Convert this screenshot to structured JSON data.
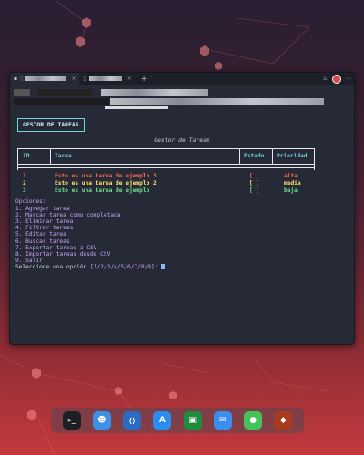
{
  "colors": {
    "accent": "#6fd3d8",
    "priority_high": "#ff6b4a",
    "priority_medium": "#ffe566",
    "priority_low": "#6be08a",
    "menu": "#c6a0f5"
  },
  "titlebar": {
    "tab_icon_1": "window-icon",
    "tab_icon_2": "terminal-icon",
    "new_tab": "+",
    "dropdown": "˅",
    "more": "⋯"
  },
  "app": {
    "title_button": "GESTOR DE TAREAS",
    "subtitle": "Gestor de Tareas"
  },
  "table": {
    "headers": [
      "ID",
      "Tarea",
      "Estado",
      "Prioridad"
    ],
    "rows": [
      {
        "id": "1",
        "task": "Esto es una tarea de ejemplo 3",
        "status": "[ ]",
        "priority": "alta",
        "color": "#ff6b4a"
      },
      {
        "id": "2",
        "task": "Esto es una tarea de ejemplo 2",
        "status": "[ ]",
        "priority": "media",
        "color": "#ffe566"
      },
      {
        "id": "3",
        "task": "Esto es una tarea de ejemplo",
        "status": "[ ]",
        "priority": "baja",
        "color": "#6be08a"
      }
    ]
  },
  "menu": {
    "heading": "Opciones:",
    "items": [
      "1. Agregar tarea",
      "2. Marcar tarea como completada",
      "3. Eliminar tarea",
      "4. Filtrar tareas",
      "5. Editar tarea",
      "6. Buscar tareas",
      "7. Exportar tareas a CSV",
      "8. Importar tareas desde CSV",
      "9. Salir"
    ]
  },
  "prompt": {
    "text": "Seleccione una opción ",
    "options": "[1/2/3/4/5/6/7/8/9]:"
  },
  "dock": [
    {
      "name": "terminal-icon",
      "glyph": ">_",
      "bg": "#1d1f24"
    },
    {
      "name": "finder-face-icon",
      "glyph": "☻",
      "bg": "#3e8fe6"
    },
    {
      "name": "vscode-icon",
      "glyph": "⟨⟩",
      "bg": "#2a6cc2"
    },
    {
      "name": "app-store-icon",
      "glyph": "A",
      "bg": "#2b8df2"
    },
    {
      "name": "google-classroom-icon",
      "glyph": "▣",
      "bg": "#1e8e3e"
    },
    {
      "name": "mail-icon",
      "glyph": "✉",
      "bg": "#3a8ef0"
    },
    {
      "name": "messages-icon",
      "glyph": "●",
      "bg": "#43c358"
    },
    {
      "name": "game-icon",
      "glyph": "◆",
      "bg": "#a83a1e"
    }
  ]
}
